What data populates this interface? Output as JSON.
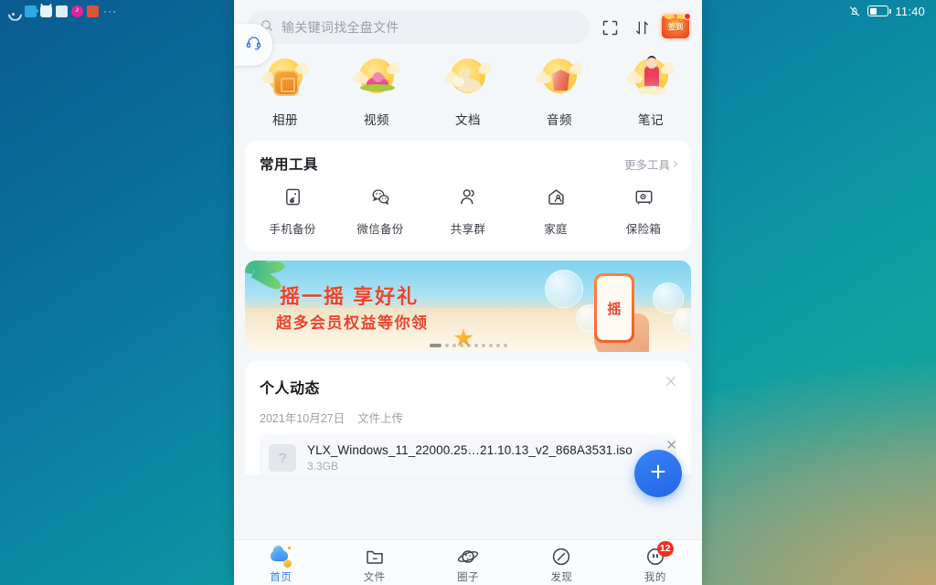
{
  "status_bar": {
    "left_tray_icons": [
      "wifi-icon",
      "camera-icon",
      "bilibili-icon",
      "mail-icon",
      "music-icon",
      "document-icon",
      "more-icon"
    ],
    "more_label": "···",
    "notification_icon": "bell-muted-icon",
    "battery_icon": "battery-icon",
    "battery_percent": 40,
    "time": "11:40"
  },
  "header": {
    "search": {
      "icon": "search-icon",
      "placeholder": "输关键词找全盘文件",
      "value": ""
    },
    "scan_icon": "scan-frame-icon",
    "sort_icon": "sort-arrows-icon",
    "signin": {
      "icon": "gift-box-icon",
      "label": "签到",
      "has_dot": true
    }
  },
  "categories": [
    {
      "label": "相册",
      "icon": "mooncake-moon-icon"
    },
    {
      "label": "视频",
      "icon": "lotus-moon-icon"
    },
    {
      "label": "文档",
      "icon": "rabbit-moon-icon"
    },
    {
      "label": "音频",
      "icon": "lantern-moon-icon"
    },
    {
      "label": "笔记",
      "icon": "change-fairy-moon-icon"
    }
  ],
  "tools": {
    "title": "常用工具",
    "more_label": "更多工具",
    "more_icon": "chevron-right-icon",
    "items": [
      {
        "label": "手机备份",
        "icon": "phone-backup-icon"
      },
      {
        "label": "微信备份",
        "icon": "wechat-icon"
      },
      {
        "label": "共享群",
        "icon": "user-group-icon"
      },
      {
        "label": "家庭",
        "icon": "home-family-icon"
      },
      {
        "label": "保险箱",
        "icon": "safe-box-icon"
      }
    ]
  },
  "banner": {
    "title": "摇一摇 享好礼",
    "subtitle": "超多会员权益等你领",
    "phone_text": "摇",
    "service_icon": "headset-support-icon",
    "dots_total": 10,
    "dots_active_index": 0
  },
  "activity": {
    "title": "个人动态",
    "close_icon": "close-x-icon",
    "date": "2021年10月27日",
    "action": "文件上传",
    "file": {
      "thumb_icon": "unknown-file-icon",
      "thumb_glyph": "?",
      "name": "YLX_Windows_11_22000.25…21.10.13_v2_868A3531.iso",
      "size": "3.3GB"
    }
  },
  "fab": {
    "icon": "plus-icon",
    "glyph": "+",
    "close_glyph": "✕",
    "color": "#2f74e8"
  },
  "bottom_nav": {
    "items": [
      {
        "label": "首页",
        "icon": "cloud-home-icon",
        "active": true,
        "badge": ""
      },
      {
        "label": "文件",
        "icon": "folder-icon",
        "active": false,
        "badge": ""
      },
      {
        "label": "圈子",
        "icon": "planet-circle-icon",
        "active": false,
        "badge": ""
      },
      {
        "label": "发现",
        "icon": "compass-icon",
        "active": false,
        "badge": ""
      },
      {
        "label": "我的",
        "icon": "face-profile-icon",
        "active": false,
        "badge": "12"
      }
    ]
  },
  "colors": {
    "accent": "#2f80ed",
    "badge_red": "#ef3124",
    "banner_red": "#e8442c",
    "panel_bg": "#f4f7fa"
  }
}
